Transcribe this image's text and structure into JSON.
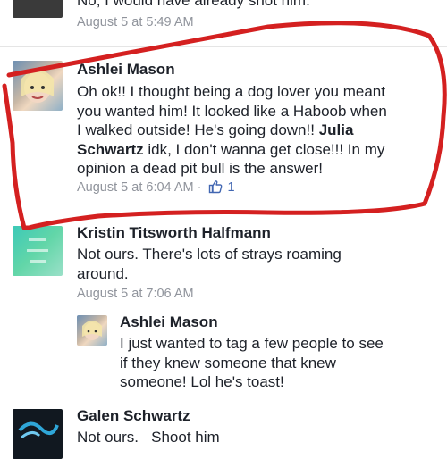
{
  "comments": [
    {
      "text": "No, I would have already shot him.",
      "time": "August 5 at 5:49 AM"
    },
    {
      "author": "Ashlei Mason",
      "text_lines": [
        "Oh ok!! I thought being a dog lover you meant",
        "you wanted him! It looked like a Haboob when",
        "I walked outside! He's going down!!"
      ],
      "mention": "Julia",
      "mention_line2": "Schwartz",
      "text_after_mention": "idk, I don't wanna get close!!! In my",
      "text_last": "opinion a dead pit bull is the answer!",
      "time": "August 5 at 6:04 AM",
      "separator": "·",
      "like_count": "1"
    },
    {
      "author": "Kristin Titsworth Halfmann",
      "text_lines": [
        "Not ours. There's lots of strays roaming",
        "around."
      ],
      "time": "August 5 at 7:06 AM"
    },
    {
      "author": "Ashlei Mason",
      "text_lines": [
        "I just wanted to tag a few people to see",
        "if they knew someone that knew",
        "someone! Lol he's toast!"
      ]
    },
    {
      "author": "Galen Schwartz",
      "text_lines": [
        "Not ours.   Shoot him"
      ]
    }
  ],
  "colors": {
    "annotation": "#d42020",
    "like_blue": "#4267b2",
    "meta_gray": "#90949c"
  }
}
